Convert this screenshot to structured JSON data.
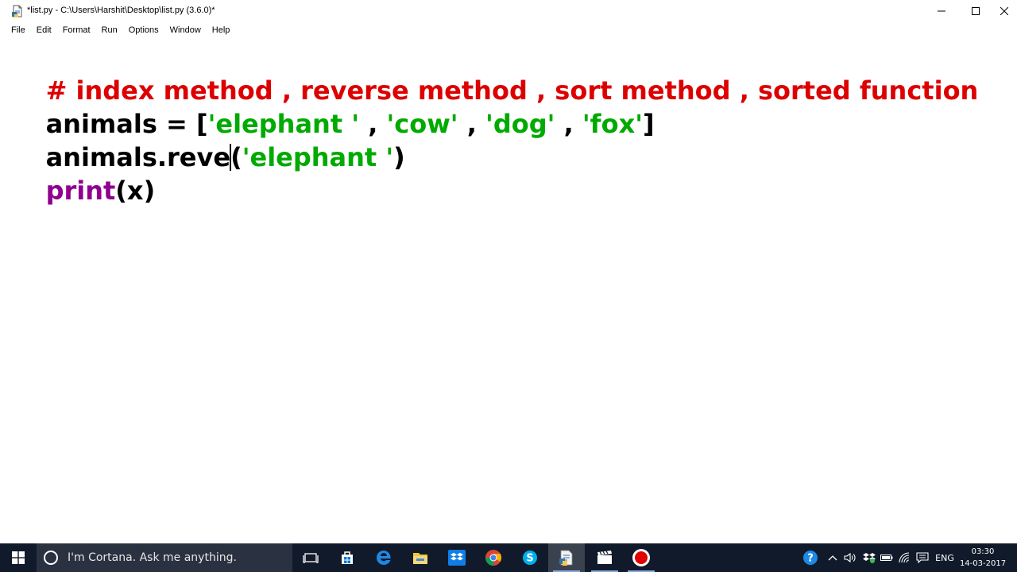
{
  "window": {
    "title": "*list.py - C:\\Users\\Harshit\\Desktop\\list.py (3.6.0)*"
  },
  "menu": {
    "items": [
      "File",
      "Edit",
      "Format",
      "Run",
      "Options",
      "Window",
      "Help"
    ]
  },
  "editor": {
    "line1": {
      "comment": "# index method , reverse method , sort method , sorted function"
    },
    "line2": {
      "lhs": "animals = [",
      "s1": "'elephant '",
      "sep1": " , ",
      "s2": "'cow'",
      "sep2": " , ",
      "s3": "'dog'",
      "sep3": " , ",
      "s4": "'fox'",
      "close": "]"
    },
    "line3": {
      "before_caret": "animals.reve",
      "after_caret": "(",
      "arg": "'elephant '",
      "close": ")"
    },
    "line4": {
      "builtin": "print",
      "rest": "(x)"
    }
  },
  "taskbar": {
    "search_placeholder": "I'm Cortana. Ask me anything.",
    "apps": [
      "task-view-icon",
      "store-icon",
      "edge-icon",
      "file-explorer-icon",
      "dropbox-icon",
      "chrome-icon",
      "skype-icon",
      "python-idle-icon",
      "video-editor-icon",
      "screen-recorder-icon"
    ],
    "language": "ENG",
    "time": "03:30",
    "date": "14-03-2017"
  },
  "colors": {
    "comment": "#dd0000",
    "string": "#00aa00",
    "builtin": "#900090",
    "default": "#000000",
    "taskbar": "#101a2a"
  }
}
